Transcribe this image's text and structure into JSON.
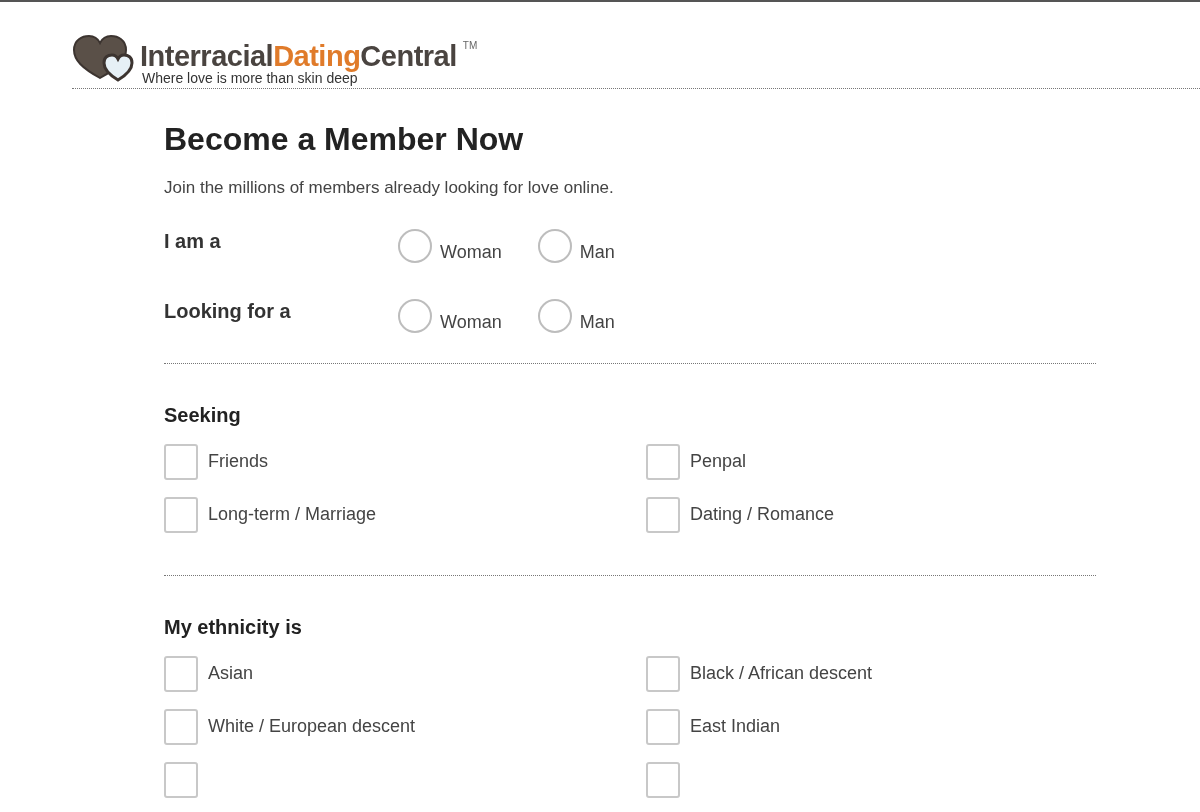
{
  "logo": {
    "parts": [
      {
        "text": "Interracial",
        "color": "#4a4440"
      },
      {
        "text": "Dating",
        "color": "#e07b2a"
      },
      {
        "text": "Central",
        "color": "#4a4440"
      }
    ],
    "trademark": "TM",
    "tagline": "Where love is more than skin deep"
  },
  "form": {
    "title": "Become a Member Now",
    "subtitle": "Join the millions of members already looking for love online.",
    "radio_groups": [
      {
        "label": "I am a",
        "options": [
          {
            "label": "Woman",
            "selected": false
          },
          {
            "label": "Man",
            "selected": false
          }
        ]
      },
      {
        "label": "Looking for a",
        "options": [
          {
            "label": "Woman",
            "selected": false
          },
          {
            "label": "Man",
            "selected": false
          }
        ]
      }
    ],
    "checkbox_sections": [
      {
        "title": "Seeking",
        "items": [
          {
            "label": "Friends",
            "checked": false
          },
          {
            "label": "Penpal",
            "checked": false
          },
          {
            "label": "Long-term / Marriage",
            "checked": false
          },
          {
            "label": "Dating / Romance",
            "checked": false
          }
        ]
      },
      {
        "title": "My ethnicity is",
        "items": [
          {
            "label": "Asian",
            "checked": false
          },
          {
            "label": "Black / African descent",
            "checked": false
          },
          {
            "label": "White / European descent",
            "checked": false
          },
          {
            "label": "East Indian",
            "checked": false
          },
          {
            "checked": false
          },
          {
            "checked": false
          }
        ]
      }
    ]
  }
}
